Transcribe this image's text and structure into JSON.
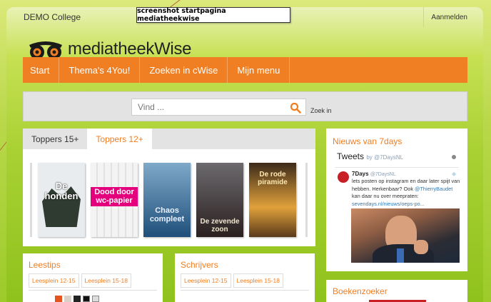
{
  "topbar": {
    "college": "DEMO College",
    "login": "Aanmelden"
  },
  "caption": "screenshot startpagina mediatheekwise",
  "brand": {
    "name": "mediatheekWise"
  },
  "nav": {
    "items": [
      "Start",
      "Thema's 4You!",
      "Zoeken in cWise",
      "Mijn menu"
    ]
  },
  "search": {
    "placeholder": "Vind ...",
    "icon": "search-icon",
    "zoek_in_label": "Zoek in"
  },
  "toppers": {
    "tabs": [
      "Toppers 15+",
      "Toppers 12+"
    ],
    "active_tab": "Toppers 12+",
    "books": [
      {
        "title": "De honden",
        "color": "#e9ecef"
      },
      {
        "title": "Dood door wc-papier",
        "color": "#ffffff"
      },
      {
        "title": "Chaos compleet",
        "color": "#1f4f7a"
      },
      {
        "title": "De zevende zoon",
        "color": "#3b2b22"
      },
      {
        "title": "De rode piramide",
        "color": "#e0a13a"
      }
    ]
  },
  "news": {
    "title": "Nieuws van 7days",
    "tweets_title": "Tweets",
    "tweets_by": "by @7DaysNL",
    "tweet": {
      "name": "7Days",
      "handle": "@7DaysNL",
      "text": "lets posten op instagram en daar later spijt van hebben. Herkenbaar? Ook ",
      "mention": "@ThierryBaudet",
      "text2": " kan daar nu over meepraten: ",
      "link": "sevendays.nl/nieuws/oeps-po..."
    }
  },
  "leestips": {
    "title": "Leestips",
    "tabs": [
      "Leesplein 12-15",
      "Leesplein 15-18"
    ]
  },
  "schrijvers": {
    "title": "Schrijvers",
    "tabs": [
      "Leesplein 12-15",
      "Leesplein 15-18"
    ]
  },
  "boekenzoeker": {
    "title": "Boekenzoeker"
  },
  "colors": {
    "accent": "#f07e22",
    "nav": "#f07e22",
    "background": "#a9d134"
  }
}
